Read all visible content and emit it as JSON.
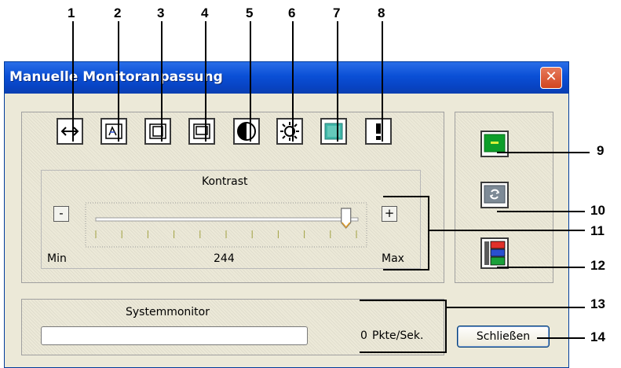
{
  "dialog": {
    "title": "Manuelle Monitoranpassung",
    "close_glyph": "✕"
  },
  "toolbar": {
    "icons": [
      "h-size-icon",
      "position-icon",
      "v-size-icon",
      "h-position-icon",
      "contrast-icon",
      "brightness-icon",
      "color-icon",
      "info-icon"
    ]
  },
  "contrast": {
    "label": "Kontrast",
    "minus_label": "-",
    "plus_label": "+",
    "min_label": "Min",
    "max_label": "Max",
    "value_text": "244",
    "value_fraction": 0.96
  },
  "system_monitor": {
    "label": "Systemmonitor",
    "rate_value": "0",
    "rate_unit": "Pkte/Sek.",
    "progress_fraction": 0
  },
  "close_button_label": "Schließen",
  "side_buttons": [
    "green-screen-icon",
    "refresh-icon",
    "color-bars-icon"
  ],
  "callouts": {
    "top": [
      "1",
      "2",
      "3",
      "4",
      "5",
      "6",
      "7",
      "8"
    ],
    "right": [
      "9",
      "10",
      "11",
      "12",
      "13",
      "14"
    ]
  }
}
